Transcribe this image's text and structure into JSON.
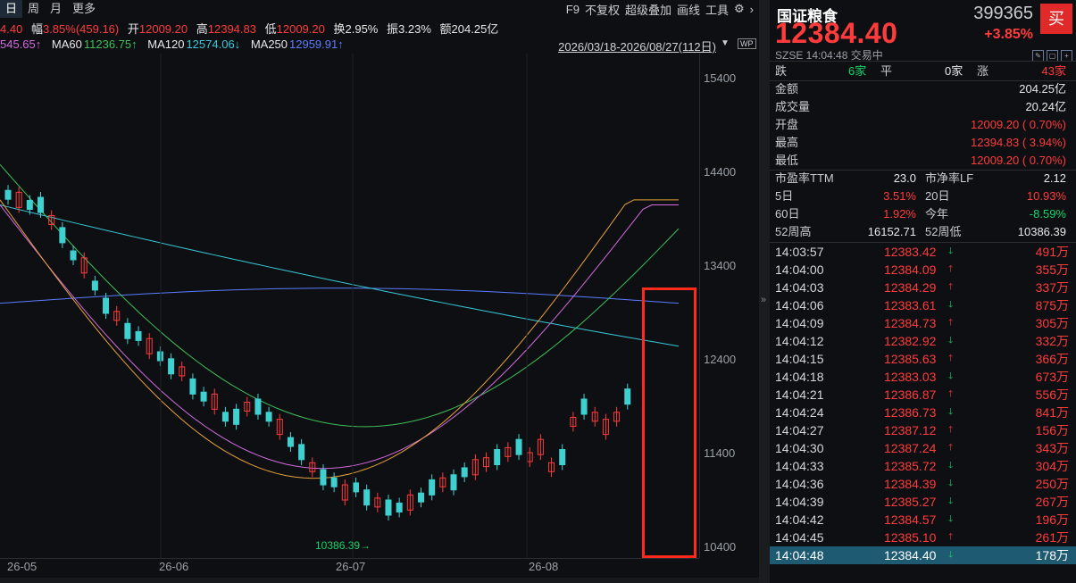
{
  "toolbar": {
    "tabs": [
      "日",
      "周",
      "月",
      "更多"
    ],
    "right_items": [
      "F9",
      "不复权",
      "超级叠加",
      "画线",
      "工具"
    ]
  },
  "info": {
    "open_prefix": "4.40",
    "amp_label": "幅",
    "amp_value": "3.85%(459.16)",
    "open_label": "开",
    "open_value": "12009.20",
    "high_label": "高",
    "high_value": "12394.83",
    "low_label": "低",
    "low_value": "12009.20",
    "turnover_label": "换",
    "turnover_value": "2.95%",
    "swing_label": "振",
    "swing_value": "3.23%",
    "amount_label": "额",
    "amount_value": "204.25亿"
  },
  "ma": {
    "ma_cut": "545.65↑",
    "ma60_label": "MA60",
    "ma60_value": "11236.75↑",
    "ma120_label": "MA120",
    "ma120_value": "12574.06↓",
    "ma250_label": "MA250",
    "ma250_value": "12959.91↑"
  },
  "range_text": "2026/03/18-2026/08/27(112日)",
  "y_ticks": [
    "15400",
    "14400",
    "13400",
    "12400",
    "11400",
    "10400"
  ],
  "x_ticks": [
    "26-05",
    "26-06",
    "26-07",
    "26-08"
  ],
  "low_marker": "10386.39",
  "colors": {
    "up": "#ff3b3b",
    "down": "#15d46b",
    "candle_down": "#3fd0d0",
    "highlight": "#ff2a1a"
  },
  "panel": {
    "name": "国证粮食",
    "code": "399365",
    "buy_label": "买",
    "price": "12384.40",
    "change_pct": "+3.85%",
    "exchange": "SZSE  14:04:48  交易中",
    "breadth": {
      "down_label": "跌",
      "down": "6家",
      "flat_label": "平",
      "flat": "0家",
      "up_label": "涨",
      "up": "43家"
    },
    "amount_label": "金额",
    "amount": "204.25亿",
    "volume_label": "成交量",
    "volume": "20.24亿",
    "open_label": "开盘",
    "open": "12009.20 ( 0.70%)",
    "high_label": "最高",
    "high": "12394.83 ( 3.94%)",
    "low_label": "最低",
    "low": "12009.20 ( 0.70%)",
    "pe_label": "市盈率TTM",
    "pe": "23.0",
    "pb_label": "市净率LF",
    "pb": "2.12",
    "d5_label": "5日",
    "d5": "3.51%",
    "d20_label": "20日",
    "d20": "10.93%",
    "d60_label": "60日",
    "d60": "1.92%",
    "ytd_label": "今年",
    "ytd": "-8.59%",
    "w52h_label": "52周高",
    "w52h": "16152.71",
    "w52l_label": "52周低",
    "w52l": "10386.39"
  },
  "trades": [
    {
      "time": "14:03:57",
      "price": "12383.42",
      "dir": "down",
      "vol": "491万"
    },
    {
      "time": "14:04:00",
      "price": "12384.09",
      "dir": "up",
      "vol": "355万"
    },
    {
      "time": "14:04:03",
      "price": "12384.29",
      "dir": "up",
      "vol": "337万"
    },
    {
      "time": "14:04:06",
      "price": "12383.61",
      "dir": "down",
      "vol": "875万"
    },
    {
      "time": "14:04:09",
      "price": "12384.73",
      "dir": "up",
      "vol": "305万"
    },
    {
      "time": "14:04:12",
      "price": "12382.92",
      "dir": "down",
      "vol": "332万"
    },
    {
      "time": "14:04:15",
      "price": "12385.63",
      "dir": "up",
      "vol": "366万"
    },
    {
      "time": "14:04:18",
      "price": "12383.03",
      "dir": "down",
      "vol": "673万"
    },
    {
      "time": "14:04:21",
      "price": "12386.87",
      "dir": "up",
      "vol": "556万"
    },
    {
      "time": "14:04:24",
      "price": "12386.73",
      "dir": "down",
      "vol": "841万"
    },
    {
      "time": "14:04:27",
      "price": "12387.12",
      "dir": "up",
      "vol": "156万"
    },
    {
      "time": "14:04:30",
      "price": "12387.24",
      "dir": "up",
      "vol": "343万"
    },
    {
      "time": "14:04:33",
      "price": "12385.72",
      "dir": "down",
      "vol": "304万"
    },
    {
      "time": "14:04:36",
      "price": "12384.39",
      "dir": "down",
      "vol": "250万"
    },
    {
      "time": "14:04:39",
      "price": "12385.27",
      "dir": "down",
      "vol": "267万"
    },
    {
      "time": "14:04:42",
      "price": "12384.57",
      "dir": "down",
      "vol": "196万"
    },
    {
      "time": "14:04:45",
      "price": "12385.10",
      "dir": "up",
      "vol": "261万"
    },
    {
      "time": "14:04:48",
      "price": "12384.40",
      "dir": "down",
      "vol": "178万"
    }
  ]
}
